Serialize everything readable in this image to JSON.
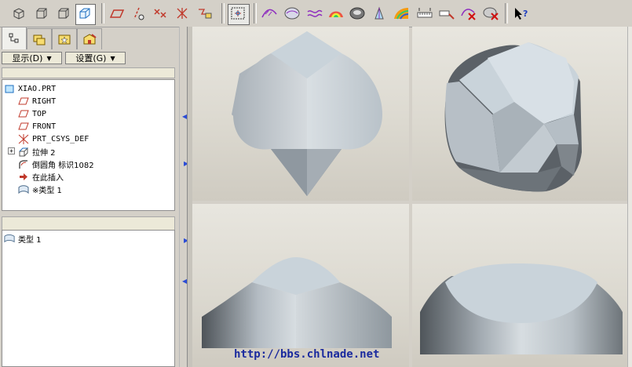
{
  "toolbar": {
    "icons": [
      "view-front-icon",
      "view-back-icon",
      "view-side-icon",
      "view-iso-icon",
      "datum-plane-icon",
      "datum-axis-icon",
      "datum-point-icon",
      "datum-csys-icon",
      "datum-sketch-icon",
      "spin-center-icon",
      "curve-analysis-icon",
      "surface-analysis-icon",
      "curvature-icon",
      "shading-icon",
      "draft-icon",
      "slope-icon",
      "reflection-icon",
      "measure-icon",
      "dimension-icon",
      "delete-analysis-icon",
      "clear-icon",
      "whats-this-icon"
    ]
  },
  "left_panel": {
    "show_button": "显示(D)",
    "settings_button": "设置(G)",
    "tree": [
      {
        "label": "XIAO.PRT",
        "icon": "part-icon"
      },
      {
        "label": "RIGHT",
        "icon": "datum-plane-icon"
      },
      {
        "label": "TOP",
        "icon": "datum-plane-icon"
      },
      {
        "label": "FRONT",
        "icon": "datum-plane-icon"
      },
      {
        "label": "PRT_CSYS_DEF",
        "icon": "csys-icon"
      },
      {
        "label": "拉伸 2",
        "icon": "extrude-icon"
      },
      {
        "label": "倒圆角 标识1082",
        "icon": "round-icon"
      },
      {
        "label": "在此插入",
        "icon": "insert-here-icon"
      },
      {
        "label": "※类型 1",
        "icon": "style-icon"
      }
    ],
    "layer_list": [
      {
        "label": "类型 1",
        "icon": "style-icon"
      }
    ]
  },
  "watermark": "http://bbs.chlnade.net",
  "colors": {
    "toolbar_bg": "#d4d0c8",
    "viewport_bg": "#dcd9d0",
    "model_light": "#c9d3da",
    "model_dark": "#5b6167",
    "watermark": "#1a2a9e"
  }
}
